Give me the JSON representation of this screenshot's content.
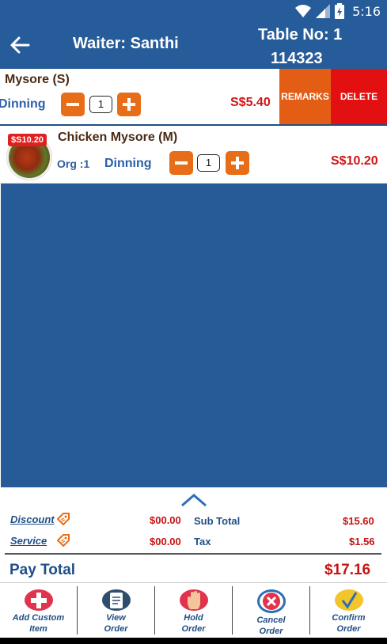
{
  "status_bar": {
    "time": "5:16",
    "icons": [
      "wifi-icon",
      "signal-icon",
      "battery-icon"
    ]
  },
  "header": {
    "waiter": "Waiter: Santhi",
    "table_no": "Table No: 1",
    "order_no": "114323"
  },
  "items": [
    {
      "name": "Mysore (S)",
      "mode": "Dinning",
      "qty": "1",
      "price": "S$5.40",
      "actions": {
        "remarks": "REMARKS",
        "delete": "DELETE"
      }
    },
    {
      "name": "Chicken Mysore (M)",
      "tag_price": "$S10.20",
      "org": "Org :1",
      "mode": "Dinning",
      "qty": "1",
      "price": "S$10.20"
    }
  ],
  "summary": {
    "discount_label": "Discount",
    "discount_value": "$00.00",
    "service_label": "Service",
    "service_value": "$00.00",
    "subtotal_label": "Sub Total",
    "subtotal_value": "$15.60",
    "tax_label": "Tax",
    "tax_value": "$1.56",
    "pay_total_label": "Pay Total",
    "pay_total_value": "$17.16"
  },
  "bottom_actions": [
    {
      "label_line1": "Add Custom",
      "label_line2": "Item",
      "color": "#e0344e"
    },
    {
      "label_line1": "View",
      "label_line2": "Order",
      "color": "#2e4e6e"
    },
    {
      "label_line1": "Hold",
      "label_line2": "Order",
      "color": "#e0344e"
    },
    {
      "label_line1": "Cancel",
      "label_line2": "Order",
      "color": "#e0344e"
    },
    {
      "label_line1": "Confirm",
      "label_line2": "Order",
      "color": "#f3c52a"
    }
  ],
  "colors": {
    "primary": "#265c99",
    "accent_orange": "#e86d18",
    "delete_red": "#e21010",
    "price_red": "#d01414"
  }
}
